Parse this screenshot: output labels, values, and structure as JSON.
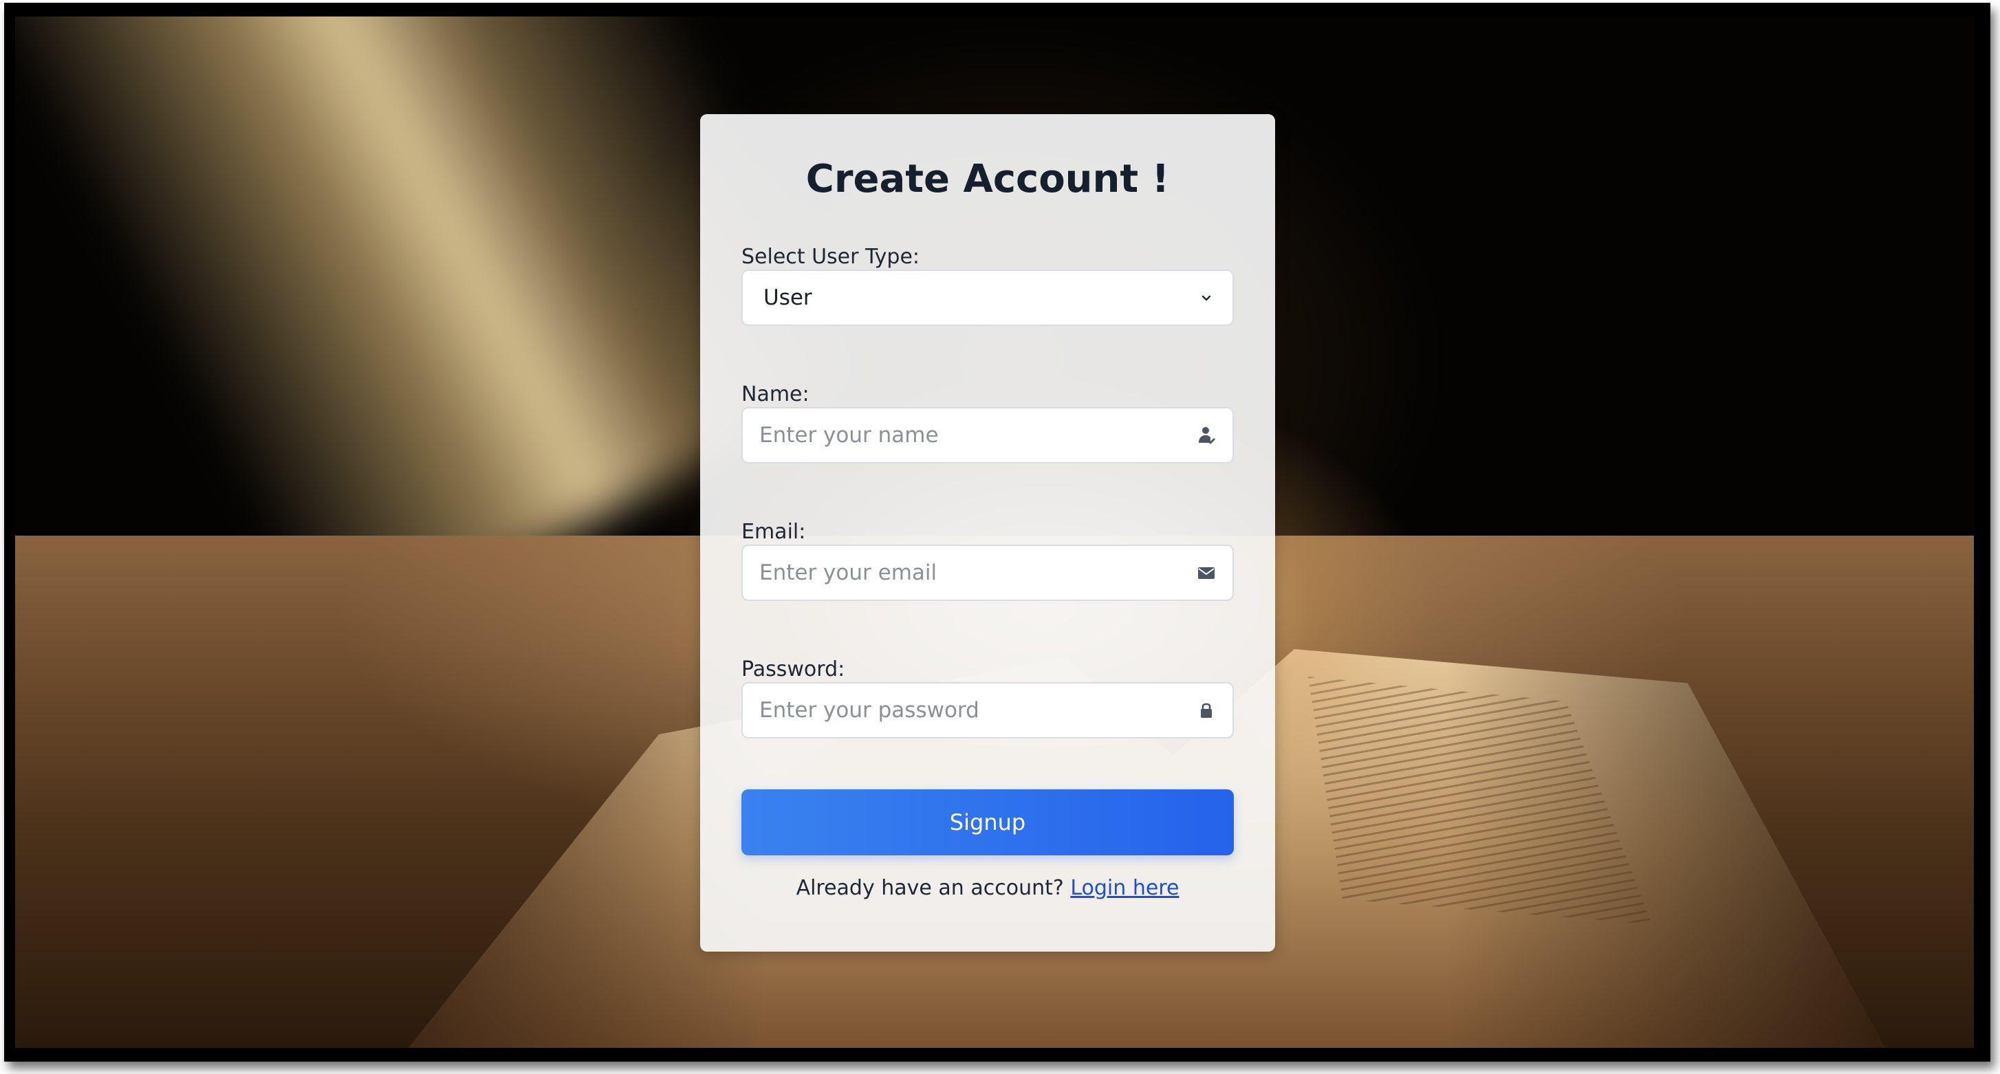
{
  "form": {
    "title": "Create Account !",
    "user_type": {
      "label": "Select User Type:",
      "selected": "User",
      "icon": "chevron-down-icon"
    },
    "name": {
      "label": "Name:",
      "placeholder": "Enter your name",
      "icon": "user-icon"
    },
    "email": {
      "label": "Email:",
      "placeholder": "Enter your email",
      "icon": "envelope-icon"
    },
    "password": {
      "label": "Password:",
      "placeholder": "Enter your password",
      "icon": "lock-icon"
    },
    "submit_label": "Signup",
    "login_prompt": "Already have an account?",
    "login_link": "Login here"
  },
  "colors": {
    "accent": "#2563eb",
    "link": "#1d4ed8",
    "title": "#16202c",
    "card": "#f6f6f6"
  }
}
